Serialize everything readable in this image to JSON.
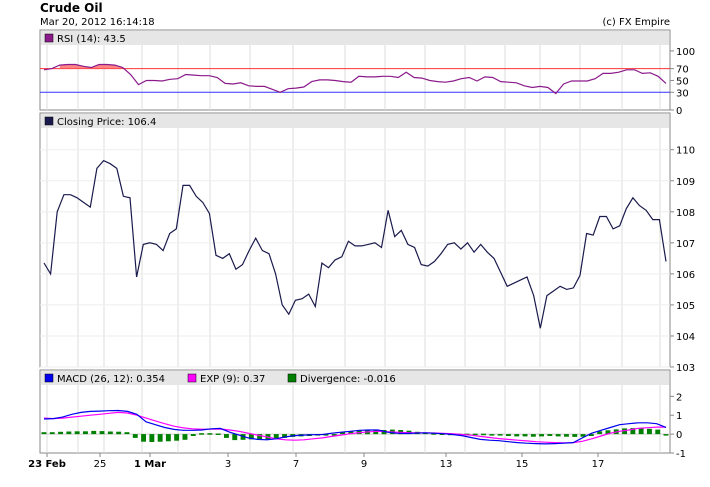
{
  "header": {
    "title": "Crude Oil",
    "timestamp": "Mar 20, 2012 16:14:18",
    "credit": "(c) FX Empire"
  },
  "chart_data": [
    {
      "type": "line",
      "panel": "rsi",
      "legend_label": "RSI (14): 43.5",
      "color": "#8b1a8b",
      "ylim": [
        0,
        110
      ],
      "yticks": [
        "0",
        "30",
        "50",
        "70",
        "100"
      ],
      "overbought": 70,
      "oversold": 30,
      "overbought_color": "#ff3333",
      "oversold_color": "#3333ff",
      "values": [
        68,
        70,
        76,
        77,
        77,
        74,
        72,
        77,
        77,
        76,
        72,
        60,
        43,
        50,
        50,
        49,
        52,
        53,
        60,
        59,
        58,
        58,
        55,
        45,
        44,
        46,
        41,
        40,
        40,
        35,
        30,
        36,
        37,
        39,
        48,
        51,
        51,
        50,
        48,
        47,
        57,
        56,
        56,
        57,
        57,
        55,
        64,
        55,
        54,
        50,
        48,
        47,
        49,
        53,
        55,
        49,
        56,
        55,
        48,
        47,
        46,
        41,
        38,
        40,
        38,
        28,
        44,
        49,
        49,
        49,
        53,
        62,
        62,
        64,
        68,
        68,
        62,
        63,
        57,
        45
      ]
    },
    {
      "type": "line",
      "panel": "price",
      "legend_label": "Closing Price: 106.4",
      "color": "#1a1a4d",
      "ylim": [
        103,
        110.7
      ],
      "yticks": [
        "103",
        "104",
        "105",
        "106",
        "107",
        "108",
        "109",
        "110"
      ],
      "values": [
        106.35,
        106.0,
        108.0,
        108.55,
        108.55,
        108.45,
        108.3,
        108.15,
        109.4,
        109.65,
        109.55,
        109.4,
        108.5,
        108.45,
        105.9,
        106.95,
        107.0,
        106.95,
        106.75,
        107.3,
        107.45,
        108.85,
        108.85,
        108.5,
        108.3,
        107.95,
        106.6,
        106.5,
        106.65,
        106.15,
        106.3,
        106.75,
        107.15,
        106.75,
        106.65,
        106.0,
        105.0,
        104.7,
        105.15,
        105.2,
        105.35,
        104.95,
        106.35,
        106.2,
        106.45,
        106.55,
        107.05,
        106.9,
        106.9,
        106.95,
        107.0,
        106.85,
        108.05,
        107.2,
        107.4,
        106.95,
        106.85,
        106.3,
        106.25,
        106.4,
        106.65,
        106.95,
        107.0,
        106.8,
        107.0,
        106.7,
        106.95,
        106.7,
        106.5,
        106.05,
        105.6,
        105.7,
        105.8,
        105.9,
        105.3,
        104.25,
        105.3,
        105.45,
        105.6,
        105.5,
        105.55,
        105.95,
        107.3,
        107.25,
        107.85,
        107.85,
        107.45,
        107.55,
        108.1,
        108.45,
        108.2,
        108.05,
        107.75,
        107.75,
        106.4
      ]
    },
    {
      "type": "line",
      "panel": "macd",
      "ylim": [
        -1,
        2.6
      ],
      "yticks": [
        "-1",
        "0",
        "1",
        "2"
      ],
      "series": [
        {
          "name": "MACD (26, 12): 0.354",
          "color": "#0000ee",
          "values": [
            0.8,
            0.82,
            0.9,
            1.05,
            1.15,
            1.2,
            1.22,
            1.24,
            1.25,
            1.2,
            1.05,
            0.65,
            0.5,
            0.35,
            0.25,
            0.2,
            0.2,
            0.22,
            0.28,
            0.3,
            0.1,
            -0.05,
            -0.2,
            -0.28,
            -0.3,
            -0.25,
            -0.15,
            -0.08,
            -0.05,
            -0.03,
            -0.02,
            0.05,
            0.1,
            0.15,
            0.2,
            0.22,
            0.22,
            0.1,
            0.05,
            0.03,
            0.05,
            0.07,
            0.05,
            0.02,
            -0.02,
            -0.08,
            -0.18,
            -0.28,
            -0.32,
            -0.35,
            -0.4,
            -0.45,
            -0.48,
            -0.5,
            -0.52,
            -0.5,
            -0.48,
            -0.45,
            -0.2,
            0.05,
            0.2,
            0.35,
            0.5,
            0.55,
            0.6,
            0.6,
            0.55,
            0.354
          ]
        },
        {
          "name": "EXP (9): 0.37",
          "color": "#ff00ff",
          "values": [
            0.85,
            0.82,
            0.85,
            0.9,
            0.95,
            1.0,
            1.05,
            1.1,
            1.15,
            1.12,
            1.0,
            0.85,
            0.7,
            0.55,
            0.42,
            0.33,
            0.28,
            0.26,
            0.26,
            0.27,
            0.22,
            0.15,
            0.05,
            -0.05,
            -0.15,
            -0.25,
            -0.3,
            -0.32,
            -0.3,
            -0.25,
            -0.2,
            -0.12,
            -0.05,
            0.02,
            0.08,
            0.12,
            0.15,
            0.13,
            0.1,
            0.08,
            0.07,
            0.07,
            0.06,
            0.04,
            0.02,
            -0.02,
            -0.06,
            -0.12,
            -0.18,
            -0.24,
            -0.28,
            -0.32,
            -0.36,
            -0.4,
            -0.43,
            -0.45,
            -0.46,
            -0.45,
            -0.38,
            -0.25,
            -0.1,
            0.05,
            0.15,
            0.22,
            0.3,
            0.34,
            0.37,
            0.37
          ]
        }
      ],
      "divergence": {
        "name": "Divergence: -0.016",
        "color": "#008000",
        "values": [
          0.1,
          0.1,
          0.12,
          0.14,
          0.15,
          0.15,
          0.17,
          0.16,
          0.14,
          0.13,
          0.1,
          -0.2,
          -0.4,
          -0.42,
          -0.4,
          -0.38,
          -0.35,
          -0.3,
          -0.1,
          0.05,
          0.05,
          0.03,
          -0.2,
          -0.32,
          -0.3,
          -0.28,
          -0.3,
          -0.28,
          -0.22,
          -0.2,
          -0.15,
          -0.12,
          -0.1,
          -0.07,
          -0.05,
          -0.02,
          0.1,
          0.15,
          0.2,
          0.22,
          0.2,
          0.22,
          0.24,
          0.22,
          0.18,
          0.12,
          0.08,
          0.05,
          0.03,
          0.02,
          0.02,
          0.02,
          0.02,
          0.02,
          -0.03,
          -0.08,
          -0.1,
          -0.12,
          -0.12,
          -0.14,
          -0.12,
          -0.1,
          -0.12,
          -0.14,
          -0.15,
          -0.14,
          -0.1,
          0.15,
          0.2,
          0.25,
          0.3,
          0.32,
          0.33,
          0.28,
          0.24,
          -0.016
        ]
      }
    }
  ],
  "x_axis": {
    "labels": [
      {
        "text": "23 Feb",
        "pos": 0,
        "bold": true
      },
      {
        "text": "25",
        "pos": 2,
        "bold": false
      },
      {
        "text": "1 Mar",
        "pos": 4,
        "bold": true
      },
      {
        "text": "3",
        "pos": 6,
        "bold": false
      },
      {
        "text": "7",
        "pos": 8,
        "bold": false
      },
      {
        "text": "9",
        "pos": 10,
        "bold": false
      },
      {
        "text": "13",
        "pos": 12,
        "bold": false
      },
      {
        "text": "15",
        "pos": 14,
        "bold": false
      },
      {
        "text": "17",
        "pos": 16,
        "bold": false
      }
    ]
  }
}
